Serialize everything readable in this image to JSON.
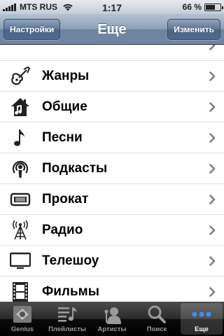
{
  "status_bar": {
    "carrier": "MTS RUS",
    "time": "1:17",
    "battery_percent": "66 %",
    "battery_level": 0.66
  },
  "nav": {
    "title": "Еще",
    "left_button": "Настройки",
    "right_button": "Изменить"
  },
  "list": {
    "items": [
      {
        "label": "",
        "icon": "partial-icon"
      },
      {
        "label": "Жанры",
        "icon": "guitar-icon"
      },
      {
        "label": "Общие",
        "icon": "house-note-icon"
      },
      {
        "label": "Песни",
        "icon": "music-note-icon"
      },
      {
        "label": "Подкасты",
        "icon": "podcast-icon"
      },
      {
        "label": "Прокат",
        "icon": "rental-icon"
      },
      {
        "label": "Радио",
        "icon": "radio-tower-icon"
      },
      {
        "label": "Телешоу",
        "icon": "tv-icon"
      },
      {
        "label": "Фильмы",
        "icon": "film-icon"
      }
    ]
  },
  "tab_bar": {
    "tabs": [
      {
        "label": "Genius",
        "icon": "genius-icon",
        "active": false
      },
      {
        "label": "Плейлисты",
        "icon": "playlists-icon",
        "active": false
      },
      {
        "label": "Артисты",
        "icon": "artists-icon",
        "active": false
      },
      {
        "label": "Поиск",
        "icon": "search-icon",
        "active": false
      },
      {
        "label": "Еще",
        "icon": "more-icon",
        "active": true
      }
    ]
  },
  "colors": {
    "nav_top": "#b4c2d2",
    "nav_bottom": "#6d85a1",
    "tab_active": "#ffffff",
    "tab_inactive": "#999999",
    "active_more_dots": "#3d8eea"
  }
}
